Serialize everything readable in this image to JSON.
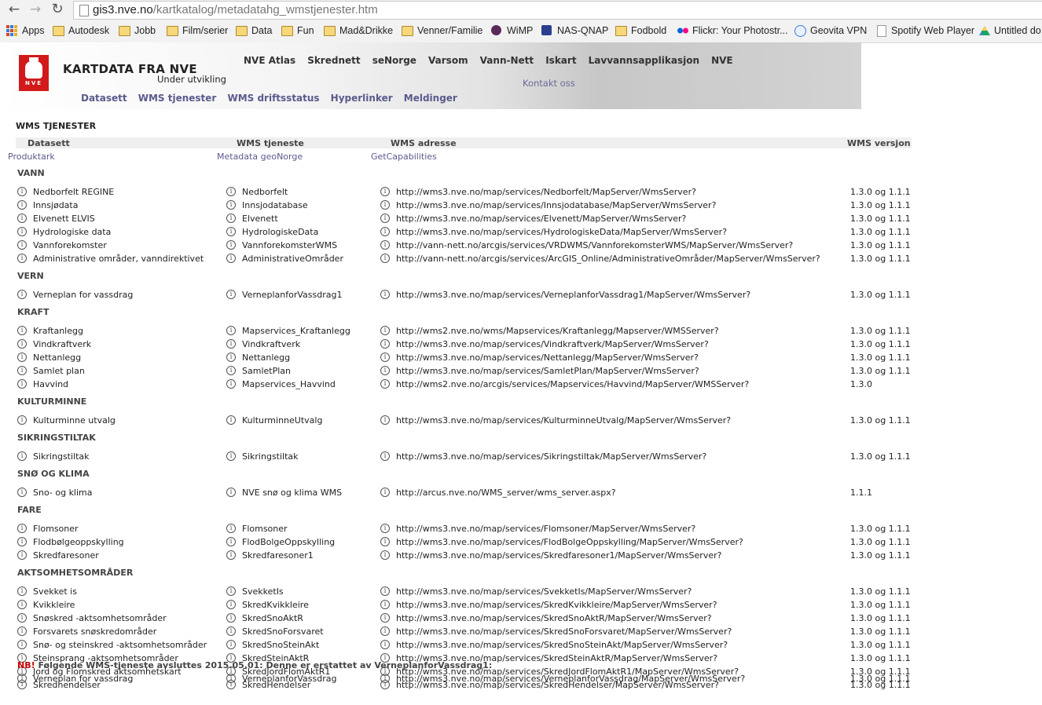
{
  "browser": {
    "url_host": "gis3.nve.no",
    "url_path": "/kartkatalog/metadatahg_wmstjenester.htm",
    "bookmarks": [
      {
        "label": "Apps",
        "icon": "apps-grid-icon"
      },
      {
        "label": "Autodesk",
        "icon": "folder-icon"
      },
      {
        "label": "Jobb",
        "icon": "folder-icon"
      },
      {
        "label": "Film/serier",
        "icon": "folder-icon"
      },
      {
        "label": "Data",
        "icon": "folder-icon"
      },
      {
        "label": "Fun",
        "icon": "folder-icon"
      },
      {
        "label": "Mad&Drikke",
        "icon": "folder-icon"
      },
      {
        "label": "Venner/Familie",
        "icon": "folder-icon"
      },
      {
        "label": "WiMP",
        "icon": "wimp-icon"
      },
      {
        "label": "NAS-QNAP",
        "icon": "qnap-icon"
      },
      {
        "label": "Fodbold",
        "icon": "folder-icon"
      },
      {
        "label": "Flickr: Your Photostr...",
        "icon": "flickr-icon"
      },
      {
        "label": "Geovita VPN",
        "icon": "globe-icon"
      },
      {
        "label": "Spotify Web Player",
        "icon": "page-icon"
      },
      {
        "label": "Untitled do",
        "icon": "drive-icon"
      }
    ],
    "colors": {
      "folder": "#f6d77a",
      "flickr_pink": "#ff0084",
      "flickr_blue": "#0063dc"
    }
  },
  "header": {
    "logo_text": "NVE",
    "title": "KARTDATA FRA NVE",
    "subtitle": "Under utvikling",
    "top_links": [
      "NVE Atlas",
      "Skrednett",
      "seNorge",
      "Varsom",
      "Vann-Nett",
      "Iskart",
      "Lavvannsapplikasjon",
      "NVE"
    ],
    "contact": "Kontakt oss",
    "sub_links": [
      "Datasett",
      "WMS tjenester",
      "WMS driftsstatus",
      "Hyperlinker",
      "Meldinger"
    ],
    "colors": {
      "logo_red": "#d21a1a",
      "link_purple": "#5a5a8c"
    }
  },
  "content": {
    "heading": "WMS TJENESTER",
    "columns": [
      "Datasett",
      "WMS tjeneste",
      "WMS adresse",
      "WMS versjon"
    ],
    "subheaders": [
      "Produktark",
      "Metadata geoNorge",
      "GetCapabilities"
    ],
    "groups": [
      {
        "title": "VANN",
        "rows": [
          [
            "Nedborfelt REGINE",
            "Nedborfelt",
            "http://wms3.nve.no/map/services/Nedborfelt/MapServer/WmsServer?",
            "1.3.0 og 1.1.1"
          ],
          [
            "Innsjødata",
            "Innsjodatabase",
            "http://wms3.nve.no/map/services/Innsjodatabase/MapServer/WmsServer?",
            "1.3.0 og 1.1.1"
          ],
          [
            "Elvenett ELVIS",
            "Elvenett",
            "http://wms3.nve.no/map/services/Elvenett/MapServer/WmsServer?",
            "1.3.0 og 1.1.1"
          ],
          [
            "Hydrologiske data",
            "HydrologiskeData",
            "http://wms3.nve.no/map/services/HydrologiskeData/MapServer/WmsServer?",
            "1.3.0 og 1.1.1"
          ],
          [
            "Vannforekomster",
            "VannforekomsterWMS",
            "http://vann-nett.no/arcgis/services/VRDWMS/VannforekomsterWMS/MapServer/WmsServer?",
            "1.3.0 og 1.1.1"
          ],
          [
            "Administrative områder, vanndirektivet",
            "AdministrativeOmråder",
            "http://vann-nett.no/arcgis/services/ArcGIS_Online/AdministrativeOmråder/MapServer/WmsServer?",
            "1.3.0 og 1.1.1"
          ]
        ]
      },
      {
        "title": "VERN",
        "rows": [
          [
            "Verneplan for vassdrag",
            "VerneplanforVassdrag1",
            "http://wms3.nve.no/map/services/VerneplanforVassdrag1/MapServer/WmsServer?",
            "1.3.0 og 1.1.1"
          ]
        ]
      },
      {
        "title": "KRAFT",
        "rows": [
          [
            "Kraftanlegg",
            "Mapservices_Kraftanlegg",
            "http://wms2.nve.no/wms/Mapservices/Kraftanlegg/Mapserver/WMSServer?",
            "1.3.0 og 1.1.1"
          ],
          [
            "Vindkraftverk",
            "Vindkraftverk",
            "http://wms3.nve.no/map/services/Vindkraftverk/MapServer/WmsServer?",
            "1.3.0 og 1.1.1"
          ],
          [
            "Nettanlegg",
            "Nettanlegg",
            "http://wms3.nve.no/map/services/Nettanlegg/MapServer/WmsServer?",
            "1.3.0 og 1.1.1"
          ],
          [
            "Samlet plan",
            "SamletPlan",
            "http://wms3.nve.no/map/services/SamletPlan/MapServer/WmsServer?",
            "1.3.0 og 1.1.1"
          ],
          [
            "Havvind",
            "Mapservices_Havvind",
            "http://wms2.nve.no/arcgis/services/Mapservices/Havvind/MapServer/WMSServer?",
            "1.3.0"
          ]
        ]
      },
      {
        "title": "KULTURMINNE",
        "rows": [
          [
            "Kulturminne utvalg",
            "KulturminneUtvalg",
            "http://wms3.nve.no/map/services/KulturminneUtvalg/MapServer/WmsServer?",
            "1.3.0 og 1.1.1"
          ]
        ]
      },
      {
        "title": "SIKRINGSTILTAK",
        "rows": [
          [
            "Sikringstiltak",
            "Sikringstiltak",
            "http://wms3.nve.no/map/services/Sikringstiltak/MapServer/WmsServer?",
            "1.3.0 og 1.1.1"
          ]
        ]
      },
      {
        "title": "SNØ OG KLIMA",
        "rows": [
          [
            "Sno- og klima",
            "NVE snø og klima WMS",
            "http://arcus.nve.no/WMS_server/wms_server.aspx?",
            "1.1.1"
          ]
        ]
      },
      {
        "title": "FARE",
        "rows": [
          [
            "Flomsoner",
            "Flomsoner",
            "http://wms3.nve.no/map/services/Flomsoner/MapServer/WmsServer?",
            "1.3.0 og 1.1.1"
          ],
          [
            "Flodbølgeoppskylling",
            "FlodBolgeOppskylling",
            "http://wms3.nve.no/map/services/FlodBolgeOppskylling/MapServer/WmsServer?",
            "1.3.0 og 1.1.1"
          ],
          [
            "Skredfaresoner",
            "Skredfaresoner1",
            "http://wms3.nve.no/map/services/Skredfaresoner1/MapServer/WmsServer?",
            "1.3.0 og 1.1.1"
          ]
        ]
      },
      {
        "title": "AKTSOMHETSOMRÅDER",
        "rows": [
          [
            "Svekket is",
            "SvekketIs",
            "http://wms3.nve.no/map/services/SvekketIs/MapServer/WmsServer?",
            "1.3.0 og 1.1.1"
          ],
          [
            "Kvikkleire",
            "SkredKvikkleire",
            "http://wms3.nve.no/map/services/SkredKvikkleire/MapServer/WmsServer?",
            "1.3.0 og 1.1.1"
          ],
          [
            "Snøskred -aktsomhetsområder",
            "SkredSnoAktR",
            "http://wms3.nve.no/map/services/SkredSnoAktR/MapServer/WmsServer?",
            "1.3.0 og 1.1.1"
          ],
          [
            "Forsvarets snøskredområder",
            "SkredSnoForsvaret",
            "http://wms3.nve.no/map/services/SkredSnoForsvaret/MapServer/WmsServer?",
            "1.3.0 og 1.1.1"
          ],
          [
            "Snø- og steinskred -aktsomhetsområder",
            "SkredSnoSteinAkt",
            "http://wms3.nve.no/map/services/SkredSnoSteinAkt/MapServer/WmsServer?",
            "1.3.0 og 1.1.1"
          ],
          [
            "Steinsprang -aktsomhetsområder",
            "SkredSteinAktR",
            "http://wms3.nve.no/map/services/SkredSteinAktR/MapServer/WmsServer?",
            "1.3.0 og 1.1.1"
          ],
          [
            "Jord og Flomskred aktsomhetskart",
            "SkredJordFlomAktR1",
            "http://wms3.nve.no/map/services/SkredJordFlomAktR1/MapServer/WmsServer?",
            "1.3.0 og 1.1.1"
          ],
          [
            "Skredhendelser",
            "SkredHendelser",
            "http://wms3.nve.no/map/services/SkredHendelser/MapServer/WmsServer?",
            "1.3.0 og 1.1.1"
          ]
        ]
      }
    ],
    "nb_tag": "NB!",
    "nb_text": " Følgende WMS-tjeneste avsluttes 2015.05.01: Denne er erstattet av VerneplanforVassdrag1:",
    "nb_row": [
      "Verneplan for vassdrag",
      "VerneplanforVassdrag",
      "http://wms3.nve.no/map/services/VerneplanforVassdrag/MapServer/WmsServer?",
      "1.3.0 og 1.1.1"
    ]
  }
}
